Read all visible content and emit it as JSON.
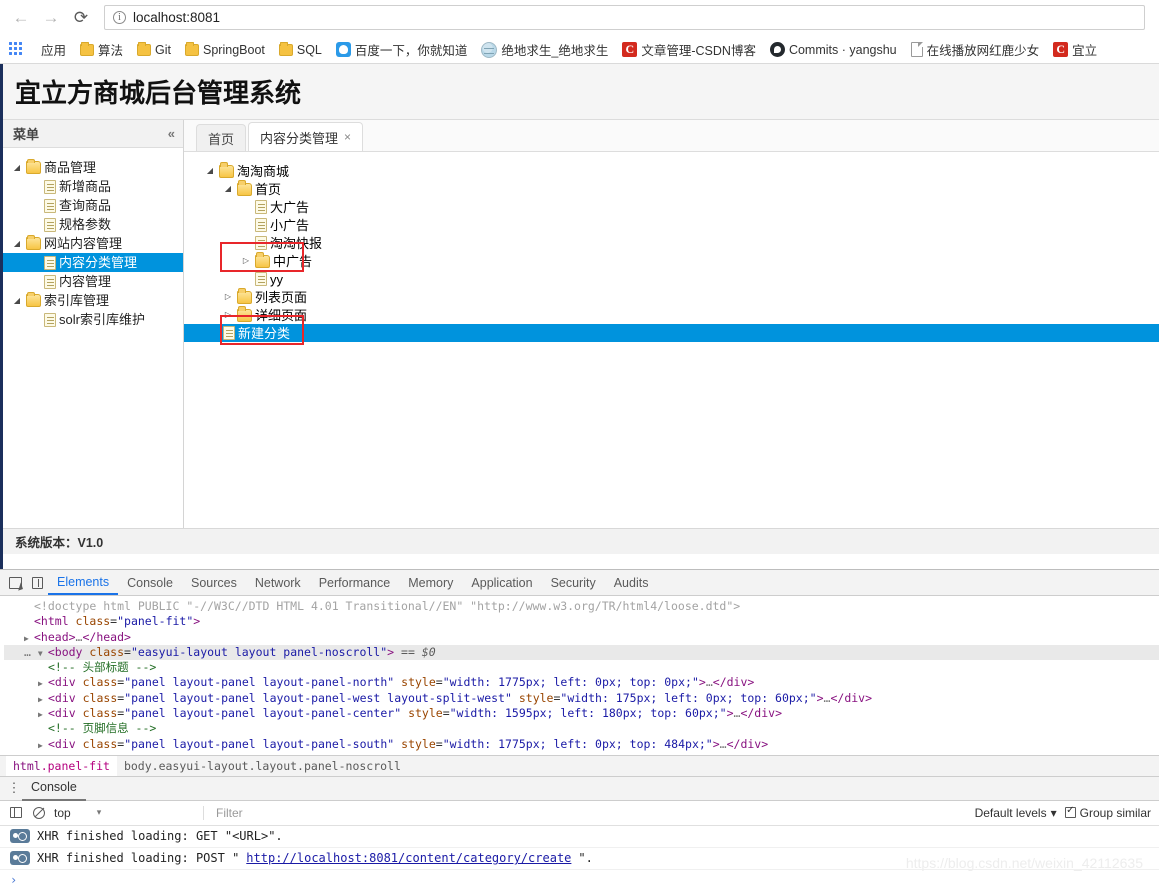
{
  "browser": {
    "back_label": "←",
    "forward_label": "→",
    "reload_label": "⟳",
    "url_scheme": "",
    "url_text": "localhost:8081",
    "info_glyph": "i",
    "apps_label": "应用",
    "bookmarks": [
      {
        "label": "算法",
        "icon": "folder-icon"
      },
      {
        "label": "Git",
        "icon": "folder-icon"
      },
      {
        "label": "SpringBoot",
        "icon": "folder-icon"
      },
      {
        "label": "SQL",
        "icon": "folder-icon"
      },
      {
        "label": "百度一下，你就知道",
        "icon": "baidu-icon"
      },
      {
        "label": "绝地求生_绝地求生",
        "icon": "globe-icon"
      },
      {
        "label": "文章管理-CSDN博客",
        "icon": "csdn-icon"
      },
      {
        "label": "Commits · yangshu",
        "icon": "github-icon"
      },
      {
        "label": "在线播放网红鹿少女",
        "icon": "page-icon"
      },
      {
        "label": "宜立",
        "icon": "csdn-icon"
      }
    ]
  },
  "app": {
    "title": "宜立方商城后台管理系统",
    "west": {
      "header": "菜单",
      "collapse_glyph": "«",
      "tree": [
        {
          "label": "商品管理",
          "type": "folder",
          "arrow": "▲",
          "indent": 0,
          "selected": false
        },
        {
          "label": "新增商品",
          "type": "doc",
          "arrow": "",
          "indent": 1,
          "selected": false
        },
        {
          "label": "查询商品",
          "type": "doc",
          "arrow": "",
          "indent": 1,
          "selected": false
        },
        {
          "label": "规格参数",
          "type": "doc",
          "arrow": "",
          "indent": 1,
          "selected": false
        },
        {
          "label": "网站内容管理",
          "type": "folder",
          "arrow": "▲",
          "indent": 0,
          "selected": false
        },
        {
          "label": "内容分类管理",
          "type": "doc",
          "arrow": "",
          "indent": 1,
          "selected": true
        },
        {
          "label": "内容管理",
          "type": "doc",
          "arrow": "",
          "indent": 1,
          "selected": false
        },
        {
          "label": "索引库管理",
          "type": "folder",
          "arrow": "▲",
          "indent": 0,
          "selected": false
        },
        {
          "label": "solr索引库维护",
          "type": "doc",
          "arrow": "",
          "indent": 1,
          "selected": false
        }
      ]
    },
    "tabs": [
      {
        "label": "首页",
        "active": false,
        "closable": false
      },
      {
        "label": "内容分类管理",
        "active": true,
        "closable": true,
        "close_glyph": "×"
      }
    ],
    "content_tree": [
      {
        "label": "淘淘商城",
        "type": "folder",
        "arrow": "▲",
        "indent": 0,
        "selected": false
      },
      {
        "label": "首页",
        "type": "folder",
        "arrow": "▲",
        "indent": 1,
        "selected": false
      },
      {
        "label": "大广告",
        "type": "doc",
        "arrow": "",
        "indent": 2,
        "selected": false
      },
      {
        "label": "小广告",
        "type": "doc",
        "arrow": "",
        "indent": 2,
        "selected": false
      },
      {
        "label": "淘淘快报",
        "type": "doc",
        "arrow": "",
        "indent": 2,
        "selected": false
      },
      {
        "label": "中广告",
        "type": "folder",
        "arrow": "▶",
        "indent": 2,
        "selected": false
      },
      {
        "label": "yy",
        "type": "doc",
        "arrow": "",
        "indent": 2,
        "selected": false
      },
      {
        "label": "列表页面",
        "type": "folder",
        "arrow": "▶",
        "indent": 1,
        "selected": false
      },
      {
        "label": "详细页面",
        "type": "folder",
        "arrow": "▶",
        "indent": 1,
        "selected": false
      },
      {
        "label": "新建分类",
        "type": "doc",
        "arrow": "",
        "indent": 1,
        "selected": true
      }
    ],
    "footer": "系统版本：V1.0",
    "highlight_color": "#0093dd",
    "redbox_color": "#e8262a"
  },
  "devtools": {
    "tabs": [
      "Elements",
      "Console",
      "Sources",
      "Network",
      "Performance",
      "Memory",
      "Application",
      "Security",
      "Audits"
    ],
    "active_tab": "Elements",
    "dom_lines": [
      {
        "indent": 1,
        "tri": "",
        "parts": [
          {
            "t": "<!doctype html PUBLIC \"-//W3C//DTD HTML 4.01 Transitional//EN\" \"http://www.w3.org/TR/html4/loose.dtd\">",
            "c": "cdoctype"
          }
        ]
      },
      {
        "indent": 1,
        "tri": "",
        "parts": [
          {
            "t": "<html",
            "c": "ctag"
          },
          {
            "t": " class",
            "c": "cattr"
          },
          {
            "t": "=",
            "c": "cpunct"
          },
          {
            "t": "\"panel-fit\"",
            "c": "cval"
          },
          {
            "t": ">",
            "c": "ctag"
          }
        ]
      },
      {
        "indent": 1,
        "tri": "▶",
        "parts": [
          {
            "t": "<head>",
            "c": "ctag"
          },
          {
            "t": "…",
            "c": "cdots"
          },
          {
            "t": "</head>",
            "c": "ctag"
          }
        ]
      },
      {
        "indent": 1,
        "tri": "▼",
        "hl": true,
        "prefix": "…",
        "parts": [
          {
            "t": "<body",
            "c": "ctag"
          },
          {
            "t": " class",
            "c": "cattr"
          },
          {
            "t": "=",
            "c": "cpunct"
          },
          {
            "t": "\"easyui-layout layout panel-noscroll\"",
            "c": "cval"
          },
          {
            "t": ">",
            "c": "ctag"
          },
          {
            "t": " == $0",
            "c": "cdollar"
          }
        ]
      },
      {
        "indent": 2,
        "tri": "",
        "parts": [
          {
            "t": "<!-- 头部标题 -->",
            "c": "ccomment"
          }
        ]
      },
      {
        "indent": 2,
        "tri": "▶",
        "parts": [
          {
            "t": "<div",
            "c": "ctag"
          },
          {
            "t": " class",
            "c": "cattr"
          },
          {
            "t": "=",
            "c": "cpunct"
          },
          {
            "t": "\"panel layout-panel layout-panel-north\"",
            "c": "cval"
          },
          {
            "t": " style",
            "c": "cattr"
          },
          {
            "t": "=",
            "c": "cpunct"
          },
          {
            "t": "\"width: 1775px; left: 0px; top: 0px;\"",
            "c": "cval"
          },
          {
            "t": ">",
            "c": "ctag"
          },
          {
            "t": "…",
            "c": "cdots"
          },
          {
            "t": "</div>",
            "c": "ctag"
          }
        ]
      },
      {
        "indent": 2,
        "tri": "▶",
        "parts": [
          {
            "t": "<div",
            "c": "ctag"
          },
          {
            "t": " class",
            "c": "cattr"
          },
          {
            "t": "=",
            "c": "cpunct"
          },
          {
            "t": "\"panel layout-panel layout-panel-west layout-split-west\"",
            "c": "cval"
          },
          {
            "t": " style",
            "c": "cattr"
          },
          {
            "t": "=",
            "c": "cpunct"
          },
          {
            "t": "\"width: 175px; left: 0px; top: 60px;\"",
            "c": "cval"
          },
          {
            "t": ">",
            "c": "ctag"
          },
          {
            "t": "…",
            "c": "cdots"
          },
          {
            "t": "</div>",
            "c": "ctag"
          }
        ]
      },
      {
        "indent": 2,
        "tri": "▶",
        "parts": [
          {
            "t": "<div",
            "c": "ctag"
          },
          {
            "t": " class",
            "c": "cattr"
          },
          {
            "t": "=",
            "c": "cpunct"
          },
          {
            "t": "\"panel layout-panel layout-panel-center\"",
            "c": "cval"
          },
          {
            "t": " style",
            "c": "cattr"
          },
          {
            "t": "=",
            "c": "cpunct"
          },
          {
            "t": "\"width: 1595px; left: 180px; top: 60px;\"",
            "c": "cval"
          },
          {
            "t": ">",
            "c": "ctag"
          },
          {
            "t": "…",
            "c": "cdots"
          },
          {
            "t": "</div>",
            "c": "ctag"
          }
        ]
      },
      {
        "indent": 2,
        "tri": "",
        "parts": [
          {
            "t": "<!-- 页脚信息 -->",
            "c": "ccomment"
          }
        ]
      },
      {
        "indent": 2,
        "tri": "▶",
        "parts": [
          {
            "t": "<div",
            "c": "ctag"
          },
          {
            "t": " class",
            "c": "cattr"
          },
          {
            "t": "=",
            "c": "cpunct"
          },
          {
            "t": "\"panel layout-panel layout-panel-south\"",
            "c": "cval"
          },
          {
            "t": " style",
            "c": "cattr"
          },
          {
            "t": "=",
            "c": "cpunct"
          },
          {
            "t": "\"width: 1775px; left: 0px; top: 484px;\"",
            "c": "cval"
          },
          {
            "t": ">",
            "c": "ctag"
          },
          {
            "t": "…",
            "c": "cdots"
          },
          {
            "t": "</div>",
            "c": "ctag"
          }
        ]
      }
    ],
    "breadcrumbs": [
      {
        "tag": "html",
        "cls": ".panel-fit",
        "active": true
      },
      {
        "tag": "body",
        "cls": ".easyui-layout.layout.panel-noscroll",
        "active": false
      }
    ]
  },
  "console": {
    "tab_label": "Console",
    "kebab_glyph": "⋮",
    "context": "top",
    "context_caret": "▾",
    "filter_placeholder": "Filter",
    "levels_label": "Default levels",
    "levels_caret": "▾",
    "group_similar_label": "Group similar",
    "messages": [
      {
        "icon": "network-icon",
        "text": "XHR finished loading: GET \"<URL>\".",
        "link": ""
      },
      {
        "icon": "question-icon",
        "text_before": "XHR finished loading: POST \"",
        "link": "http://localhost:8081/content/category/create",
        "text_after": "\"."
      }
    ],
    "prompt_glyph": "›"
  },
  "watermark": "https://blog.csdn.net/weixin_42112635"
}
